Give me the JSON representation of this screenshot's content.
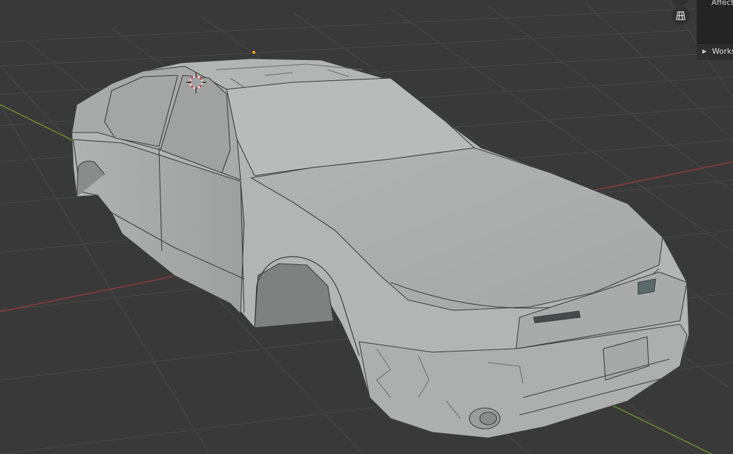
{
  "sidebar": {
    "panel_label": "Affect",
    "workspace_label": "Works"
  },
  "viewport": {
    "icons": [
      "perspective-toggle-icon",
      "grid-icon"
    ],
    "colors": {
      "background": "#393939",
      "grid": "#4a4a4a",
      "x_axis": "#8a3a3e",
      "y_axis": "#6b8b2e",
      "model": "#b9bbbb"
    }
  }
}
